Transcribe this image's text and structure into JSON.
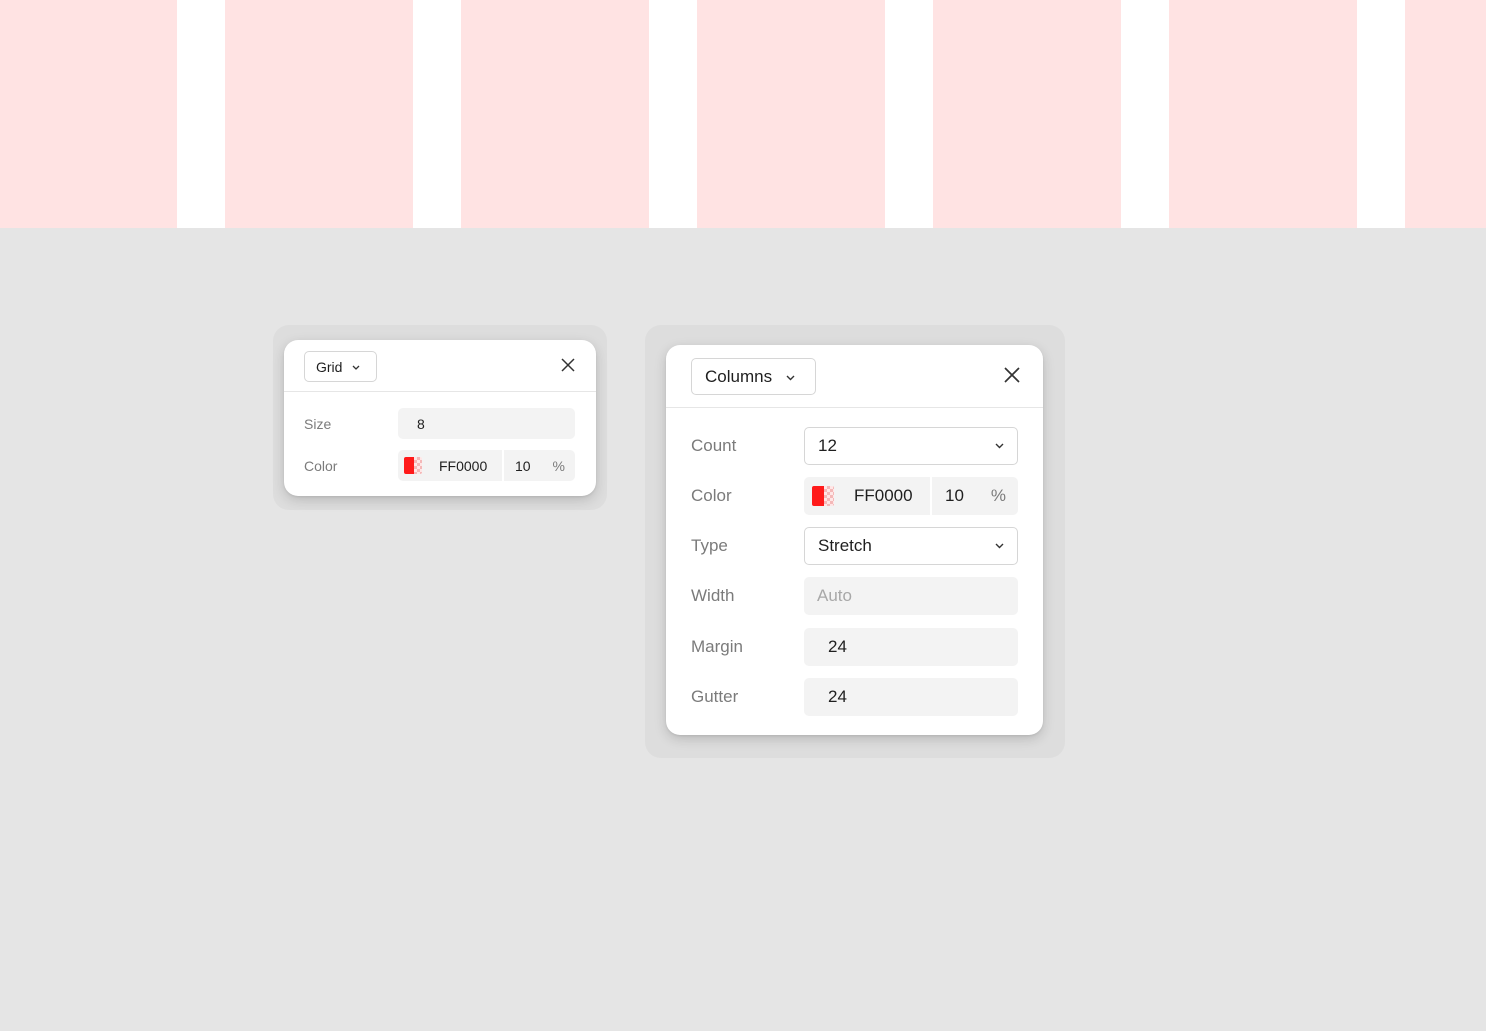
{
  "preview": {
    "column_color": "#ffe3e3"
  },
  "grid_panel": {
    "mode": "Grid",
    "close_icon": "close-icon",
    "size_label": "Size",
    "size_value": "8",
    "color_label": "Color",
    "color_hex": "FF0000",
    "opacity": "10",
    "opacity_unit": "%",
    "swatch_color": "#ff1a1a"
  },
  "columns_panel": {
    "mode": "Columns",
    "close_icon": "close-icon",
    "count_label": "Count",
    "count_value": "12",
    "color_label": "Color",
    "color_hex": "FF0000",
    "opacity": "10",
    "opacity_unit": "%",
    "swatch_color": "#ff1a1a",
    "type_label": "Type",
    "type_value": "Stretch",
    "width_label": "Width",
    "width_placeholder": "Auto",
    "margin_label": "Margin",
    "margin_value": "24",
    "gutter_label": "Gutter",
    "gutter_value": "24"
  }
}
